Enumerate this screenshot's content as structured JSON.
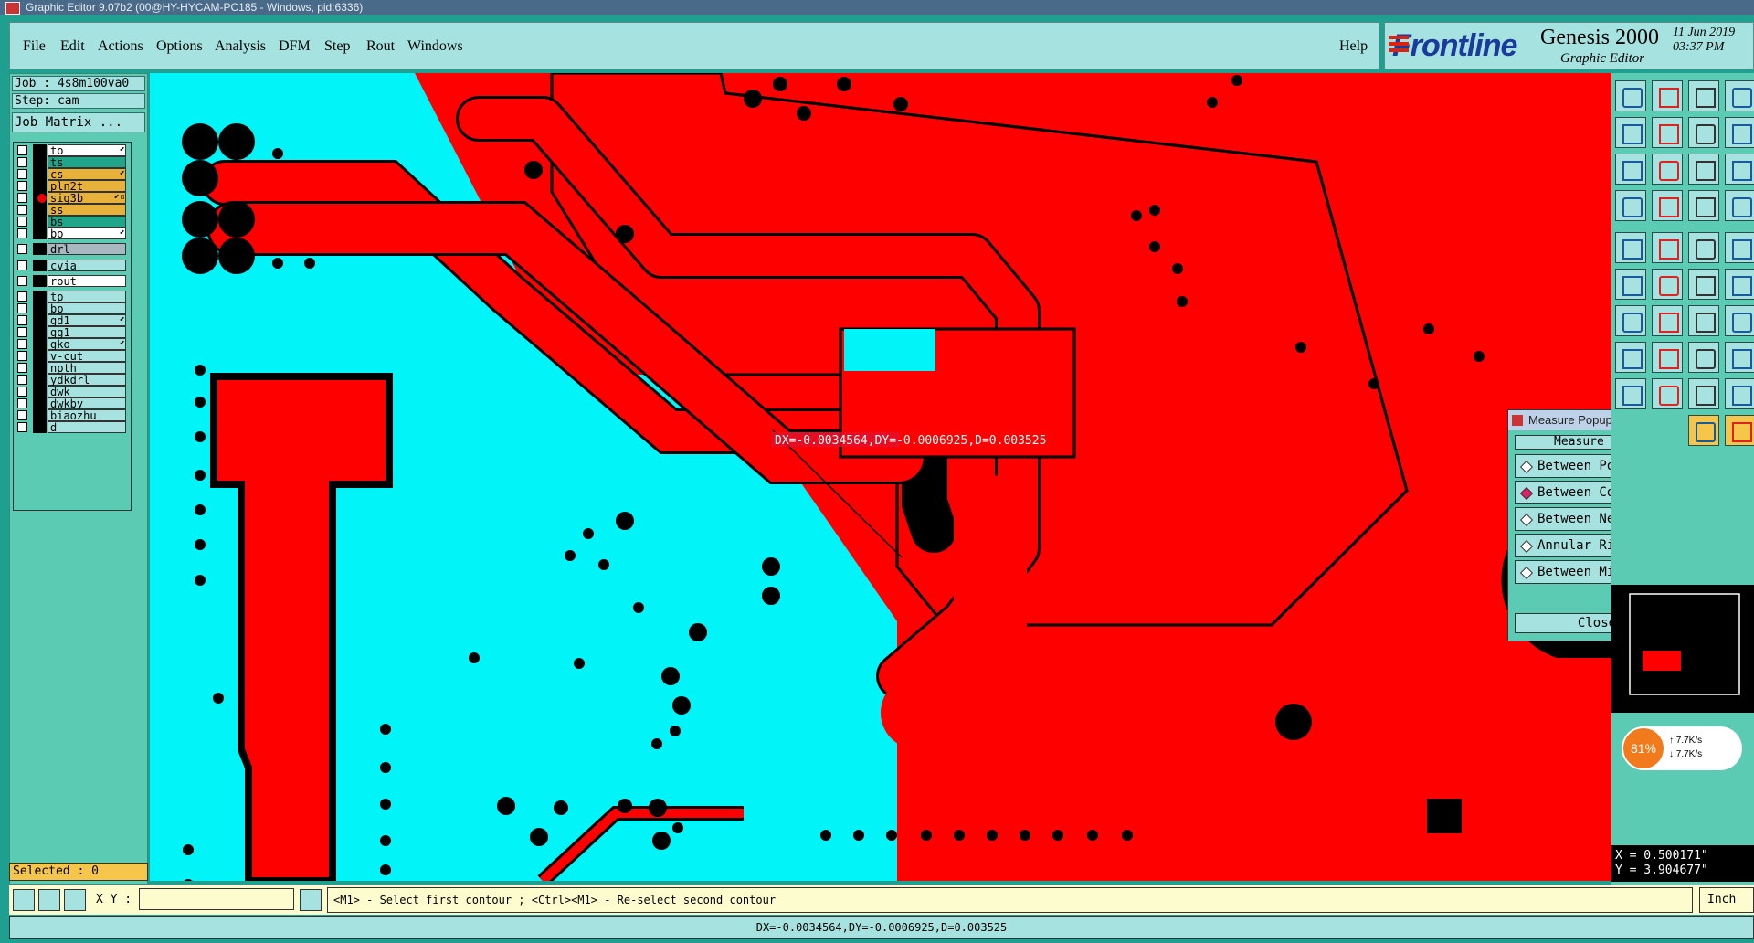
{
  "window": {
    "title": "Graphic Editor 9.07b2 (00@HY-HYCAM-PC185 - Windows, pid:6336)"
  },
  "menu": {
    "items": [
      "File",
      "Edit",
      "Actions",
      "Options",
      "Analysis",
      "DFM",
      "Step",
      "Rout",
      "Windows"
    ],
    "help": "Help"
  },
  "brand": {
    "logo": "Frontline",
    "product": "Genesis 2000",
    "subtitle": "Graphic Editor",
    "date": "11 Jun 2019",
    "time": "03:37 PM"
  },
  "job": {
    "job_label": "Job : 4s8m100va0",
    "step_label": "Step: cam",
    "matrix_button": "Job Matrix ..."
  },
  "layers": [
    {
      "name": "to",
      "color": "#ffffff",
      "mark": "⬋"
    },
    {
      "name": "ts",
      "color": "#1fa58a",
      "mark": ""
    },
    {
      "name": "cs",
      "color": "#e8b23a",
      "mark": "⬋"
    },
    {
      "name": "pln2t",
      "color": "#e8b23a",
      "mark": ""
    },
    {
      "name": "sig3b",
      "color": "#e8b23a",
      "mark": "⬋▫",
      "active": true
    },
    {
      "name": "ss",
      "color": "#e8b23a",
      "mark": ""
    },
    {
      "name": "bs",
      "color": "#1fa58a",
      "mark": ""
    },
    {
      "name": "bo",
      "color": "#ffffff",
      "mark": "⬋"
    },
    {
      "name": "drl",
      "color": "#a9b7c0",
      "mark": ""
    },
    {
      "name": "cvia",
      "color": "#a6e3e0",
      "mark": ""
    },
    {
      "name": "rout",
      "color": "#ffffff",
      "mark": ""
    },
    {
      "name": "tp",
      "color": "#a6e3e0",
      "mark": ""
    },
    {
      "name": "bp",
      "color": "#a6e3e0",
      "mark": ""
    },
    {
      "name": "gd1",
      "color": "#a6e3e0",
      "mark": "⬋"
    },
    {
      "name": "gg1",
      "color": "#a6e3e0",
      "mark": ""
    },
    {
      "name": "gko",
      "color": "#a6e3e0",
      "mark": "⬋"
    },
    {
      "name": "v-cut",
      "color": "#a6e3e0",
      "mark": ""
    },
    {
      "name": "npth",
      "color": "#a6e3e0",
      "mark": ""
    },
    {
      "name": "ydkdrl",
      "color": "#a6e3e0",
      "mark": ""
    },
    {
      "name": "dwk",
      "color": "#a6e3e0",
      "mark": ""
    },
    {
      "name": "dwkby",
      "color": "#a6e3e0",
      "mark": ""
    },
    {
      "name": "biaozhu",
      "color": "#a6e3e0",
      "mark": ""
    },
    {
      "name": "d",
      "color": "#a6e3e0",
      "mark": ""
    }
  ],
  "selected": "Selected : 0",
  "measurement": "DX=-0.0034564,DY=-0.0006925,D=0.003525",
  "popup": {
    "title": "Measure Popup",
    "close_x": "✕",
    "mode_label": "Measure Mode",
    "options": [
      {
        "label": "Between Points",
        "selected": false
      },
      {
        "label": "Between Contours",
        "selected": true
      },
      {
        "label": "Between Nets",
        "selected": false
      },
      {
        "label": "Annular Ring",
        "selected": false
      },
      {
        "label": "Between Midpoints",
        "selected": false
      }
    ],
    "close_button": "Close"
  },
  "coords": {
    "x": "X = 0.500171\"",
    "y": "Y = 3.904677\""
  },
  "bottom": {
    "xy_label": "X Y :",
    "xy_value": "",
    "prompt": "<M1> - Select first contour ; <Ctrl><M1> - Re-select second contour",
    "units": "Inch"
  },
  "status": "DX=-0.0034564,DY=-0.0006925,D=0.003525",
  "network": {
    "percent": "81%",
    "up": "7.7K/s",
    "down": "7.7K/s"
  },
  "colors": {
    "copper": "#ff0000",
    "background": "#00f4f8",
    "panel": "#5bcbb3",
    "button": "#a6e3e0",
    "highlight": "#f6c64a"
  },
  "icons": [
    "toolbar-icons"
  ]
}
